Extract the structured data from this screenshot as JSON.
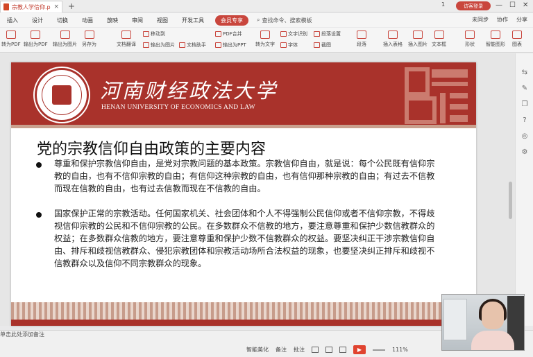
{
  "window": {
    "tab_title": "宗教人学信仰.pptx",
    "tab_close": "×",
    "new_tab": "+",
    "page_indicator": "1",
    "user": "访客登录",
    "min": "—",
    "max": "☐",
    "close": "✕"
  },
  "menu": {
    "items": [
      "插入",
      "设计",
      "切换",
      "动画",
      "放映",
      "审阅",
      "视图",
      "开发工具"
    ],
    "special": "会员专享",
    "search": "查找命令、搜索模板",
    "right": [
      "未同步",
      "协作",
      "分享"
    ]
  },
  "toolbar": {
    "buttons": [
      "转为PDF",
      "输出为PDF",
      "输出为图片",
      "另存为",
      "文档翻译",
      "输出为图片",
      "文档助手",
      "转为文字",
      "段落",
      "插入表格",
      "插入图片",
      "文本框",
      "形状",
      "智能图形",
      "图表",
      "关闭"
    ],
    "small": [
      "移动到",
      "PDF合并",
      "输出为PPT",
      "文字识别",
      "字体",
      "段落设置",
      "截图",
      "超链接",
      "对象"
    ]
  },
  "slide": {
    "university_cn": "河南财经政法大学",
    "university_en": "HENAN UNIVERSITY OF ECONOMICS AND LAW",
    "title": "党的宗教信仰自由政策的主要内容",
    "bullets": [
      "尊重和保护宗教信仰自由，是党对宗教问题的基本政策。宗教信仰自由，就是说：每个公民既有信仰宗教的自由，也有不信仰宗教的自由；有信仰这种宗教的自由，也有信仰那种宗教的自由；有过去不信教而现在信教的自由，也有过去信教而现在不信教的自由。",
      "国家保护正常的宗教活动。任何国家机关、社会团体和个人不得强制公民信仰或者不信仰宗教，不得歧视信仰宗教的公民和不信仰宗教的公民。在多数群众不信教的地方，要注意尊重和保护少数信教群众的权益；在多数群众信教的地方，要注意尊重和保护少数不信教群众的权益。要坚决纠正干涉宗教信仰自由、排斥和歧视信教群众、侵犯宗教团体和宗教活动场所合法权益的现象，也要坚决纠正排斥和歧视不信教群众以及信仰不同宗教群众的现象。"
    ]
  },
  "status": {
    "notes": "单击此处添加备注",
    "smart": "智能美化",
    "remark": "备注",
    "comment": "批注",
    "zoom": "111%"
  },
  "colors": {
    "brand": "#a9322b",
    "play": "#e0432f"
  }
}
